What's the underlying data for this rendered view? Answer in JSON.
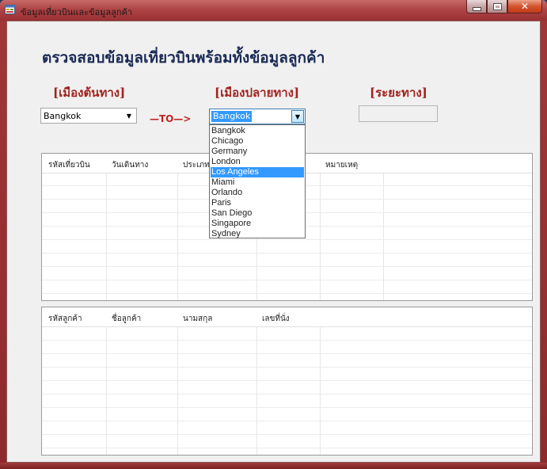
{
  "window": {
    "title": "ข้อมูลเที่ยวบินและข้อมูลลูกค้า",
    "accent": "#a03638"
  },
  "form": {
    "heading": "ตรวจสอบข้อมูลเที่ยวบินพร้อมทั้งข้อมูลลูกค้า",
    "origin_label": "[เมืองต้นทาง]",
    "destination_label": "[เมืองปลายทาง]",
    "distance_label": "[ระยะทาง]",
    "origin_value": "Bangkok",
    "destination_value": "Bangkok",
    "to_label": "—TO—>",
    "distance_value": ""
  },
  "destination_dropdown": {
    "options": [
      "Bangkok",
      "Chicago",
      "Germany",
      "London",
      "Los Angeles",
      "Miami",
      "Orlando",
      "Paris",
      "San Diego",
      "Singapore",
      "Sydney"
    ],
    "highlighted": "Los Angeles"
  },
  "flights_table": {
    "columns": [
      "รหัสเที่ยวบิน",
      "วันเดินทาง",
      "ประเภท",
      "",
      "หมายเหตุ"
    ]
  },
  "customers_table": {
    "columns": [
      "รหัสลูกค้า",
      "ชื่อลูกค้า",
      "นามสกุล",
      "เลขที่นั่ง"
    ]
  }
}
